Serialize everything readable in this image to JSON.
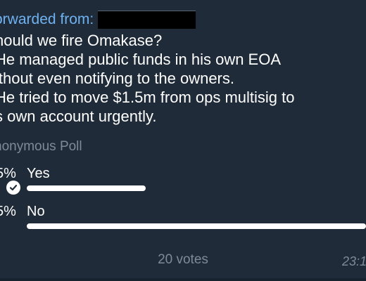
{
  "forward": {
    "label": "orwarded from:"
  },
  "message": {
    "question_lines": [
      "hould we fire Omakase?",
      " He managed public funds in his own EOA",
      "ithout even notifying to the owners.",
      " He tried to move $1.5m from ops multisig to",
      "s own account urgently."
    ]
  },
  "poll": {
    "type_label": "nonymous Poll",
    "options": [
      {
        "percent": "5%",
        "label": "Yes",
        "fraction": 0.35,
        "selected": true
      },
      {
        "percent": "5%",
        "label": "No",
        "fraction": 1.0,
        "selected": false
      }
    ],
    "votes": "20 votes"
  },
  "meta": {
    "time": "23:1"
  },
  "colors": {
    "background": "#1f2b38",
    "accent": "#6fb2f2",
    "text": "#ffffff",
    "muted": "#7d8b99",
    "bar": "#ffffff"
  },
  "icons": {
    "selected_option": "check-circle-icon"
  }
}
